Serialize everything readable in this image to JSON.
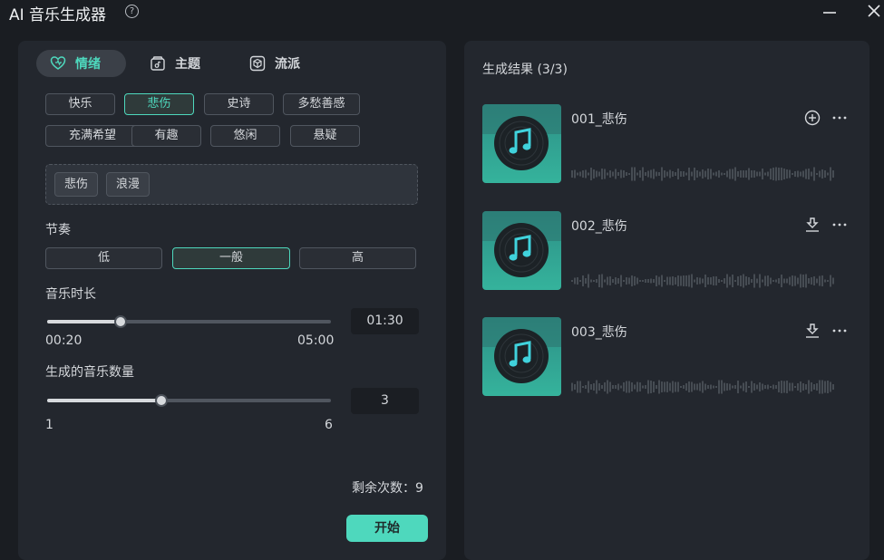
{
  "window": {
    "title": "AI 音乐生成器",
    "help_icon": "question-circle-icon"
  },
  "tabs": [
    {
      "label": "情绪",
      "icon": "heart-icon",
      "active": true
    },
    {
      "label": "主题",
      "icon": "album-icon",
      "active": false
    },
    {
      "label": "流派",
      "icon": "cube-icon",
      "active": false
    }
  ],
  "moods": [
    {
      "label": "快乐",
      "selected": false
    },
    {
      "label": "悲伤",
      "selected": true
    },
    {
      "label": "史诗",
      "selected": false
    },
    {
      "label": "多愁善感",
      "selected": false
    },
    {
      "label": "充满希望",
      "selected": false
    },
    {
      "label": "有趣",
      "selected": false
    },
    {
      "label": "悠闲",
      "selected": false
    },
    {
      "label": "悬疑",
      "selected": false
    }
  ],
  "selected_tags": [
    "悲伤",
    "浪漫"
  ],
  "tempo": {
    "label": "节奏",
    "options": [
      "低",
      "一般",
      "高"
    ],
    "selected": "一般"
  },
  "duration": {
    "label": "音乐时长",
    "min": "00:20",
    "max": "05:00",
    "value": "01:30"
  },
  "count": {
    "label": "生成的音乐数量",
    "min": "1",
    "max": "6",
    "value": "3"
  },
  "remaining_text": "剩余次数：9",
  "start_label": "开始",
  "results": {
    "title": "生成结果 (3/3)",
    "items": [
      {
        "name": "001_悲伤",
        "action_icon": "add-circle-icon"
      },
      {
        "name": "002_悲伤",
        "action_icon": "download-icon"
      },
      {
        "name": "003_悲伤",
        "action_icon": "download-icon"
      }
    ]
  },
  "colors": {
    "accent": "#4ed8bd",
    "panel": "#23272e",
    "background": "#1a1d22"
  }
}
